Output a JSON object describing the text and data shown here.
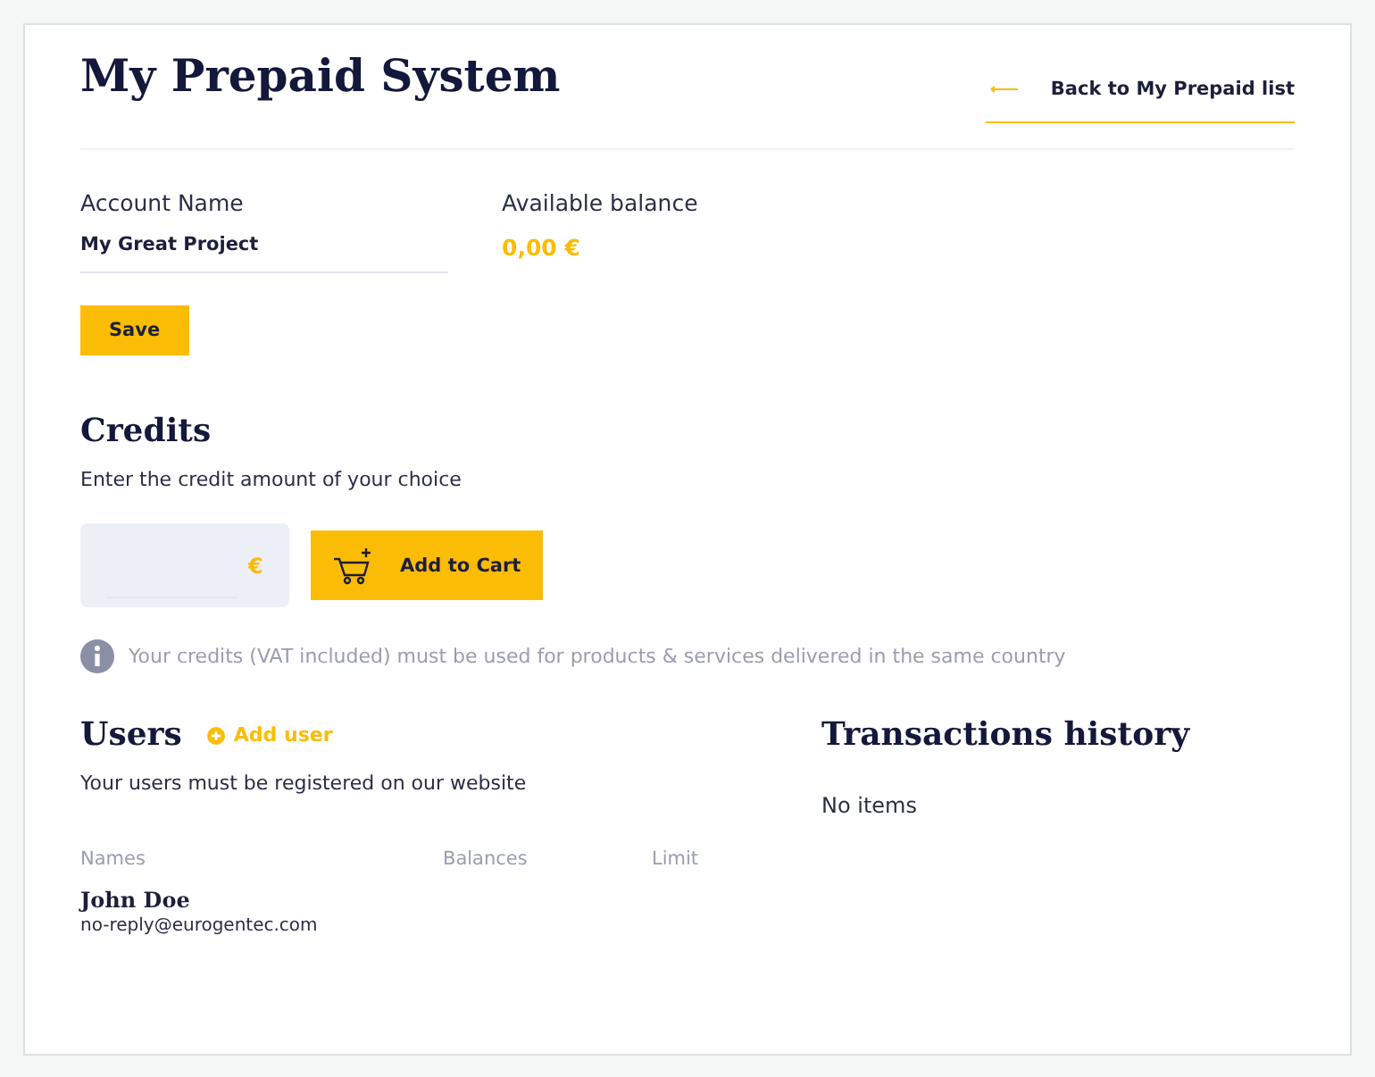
{
  "title": "My Prepaid System",
  "back_link": "Back to My Prepaid list",
  "account": {
    "label": "Account Name",
    "value": "My Great Project"
  },
  "balance": {
    "label": "Available balance",
    "value": "0,00 €"
  },
  "save_button": "Save",
  "credits": {
    "heading": "Credits",
    "hint": "Enter the credit amount of your choice",
    "currency": "€",
    "add_button": "Add to Cart",
    "note": "Your credits (VAT included) must be used for products & services delivered in the same country"
  },
  "users": {
    "heading": "Users",
    "add_link": "Add user",
    "hint": "Your users must be registered on our website",
    "columns": [
      "Names",
      "Balances",
      "Limit"
    ],
    "rows": [
      {
        "name": "John Doe",
        "email": "no-reply@eurogentec.com"
      }
    ]
  },
  "transactions": {
    "heading": "Transactions history",
    "empty": "No items"
  }
}
